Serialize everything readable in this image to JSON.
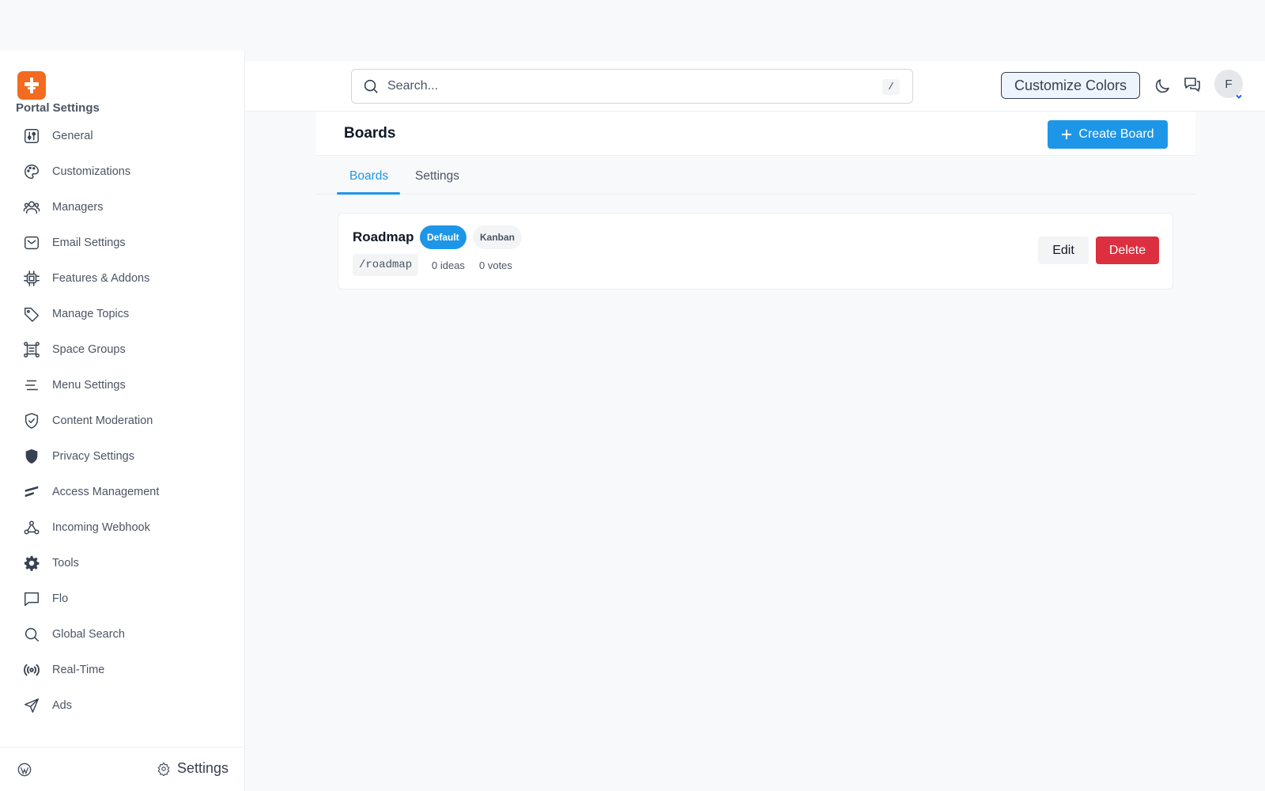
{
  "sidebar": {
    "heading": "Portal Settings",
    "items": [
      {
        "label": "General",
        "icon": "sliders-icon"
      },
      {
        "label": "Customizations",
        "icon": "palette-icon"
      },
      {
        "label": "Managers",
        "icon": "users-icon"
      },
      {
        "label": "Email Settings",
        "icon": "mail-icon"
      },
      {
        "label": "Features & Addons",
        "icon": "chip-icon"
      },
      {
        "label": "Manage Topics",
        "icon": "tag-icon"
      },
      {
        "label": "Space Groups",
        "icon": "frame-icon"
      },
      {
        "label": "Menu Settings",
        "icon": "menu-lines-icon"
      },
      {
        "label": "Content Moderation",
        "icon": "shield-check-icon"
      },
      {
        "label": "Privacy Settings",
        "icon": "shield-icon"
      },
      {
        "label": "Access Management",
        "icon": "access-icon"
      },
      {
        "label": "Incoming Webhook",
        "icon": "webhook-icon"
      },
      {
        "label": "Tools",
        "icon": "gear-icon"
      },
      {
        "label": "Flo",
        "icon": "message-square-icon"
      },
      {
        "label": "Global Search",
        "icon": "search-icon"
      },
      {
        "label": "Real-Time",
        "icon": "broadcast-icon"
      },
      {
        "label": "Ads",
        "icon": "send-icon"
      }
    ],
    "footer": {
      "settings_label": "Settings"
    }
  },
  "topbar": {
    "search_placeholder": "Search...",
    "shortcut_key": "/",
    "customize_label": "Customize Colors",
    "avatar_initial": "F"
  },
  "page": {
    "title": "Boards",
    "create_label": "Create Board",
    "tabs": [
      {
        "label": "Boards",
        "active": true
      },
      {
        "label": "Settings",
        "active": false
      }
    ]
  },
  "boards": [
    {
      "name": "Roadmap",
      "badges": [
        "Default",
        "Kanban"
      ],
      "slug": "/roadmap",
      "ideas": "0 ideas",
      "votes": "0 votes",
      "edit_label": "Edit",
      "delete_label": "Delete"
    }
  ],
  "colors": {
    "accent": "#1e96e8",
    "danger": "#dc2f3f",
    "brand": "#f26b21"
  }
}
